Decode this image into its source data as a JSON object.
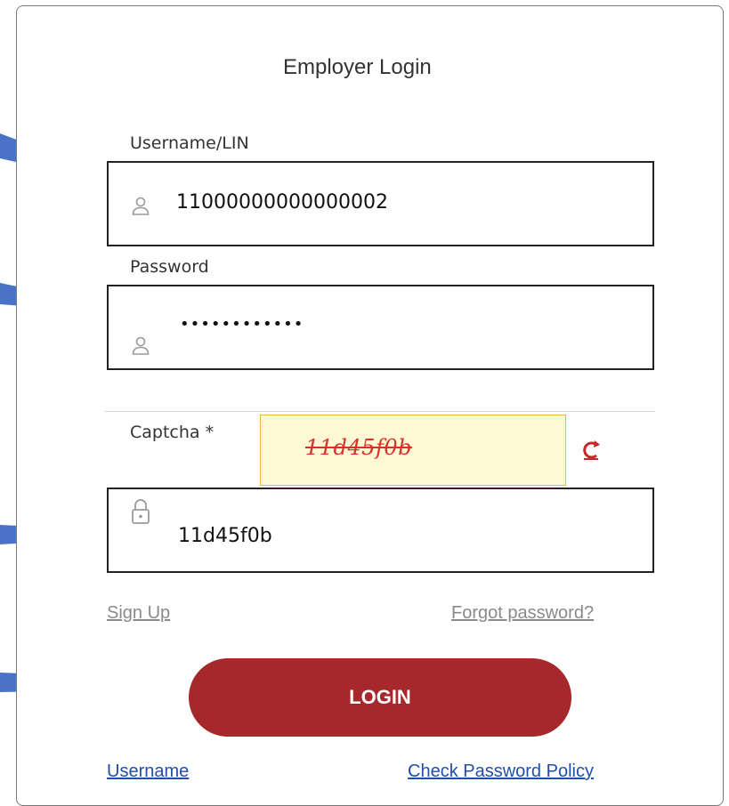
{
  "form": {
    "title": "Employer Login",
    "username": {
      "label": "Username/LIN",
      "value": "11000000000000002",
      "icon": "user-icon"
    },
    "password": {
      "label": "Password",
      "value": "••••••••••••",
      "icon": "user-icon"
    },
    "captcha": {
      "label": "Captcha *",
      "image_text": "11d45f0b",
      "refresh_icon": "refresh-icon",
      "input_value": "11d45f0b",
      "input_icon": "lock-icon"
    },
    "links": {
      "sign_up": "Sign Up",
      "forgot_password": "Forgot password?",
      "username": "Username",
      "check_password_policy": "Check Password Policy"
    },
    "login_button": "LOGIN"
  },
  "colors": {
    "login_button": "#a6282a",
    "captcha_text": "#d8302a",
    "captcha_bg": "#fff8d4",
    "link_blue": "#1f4fa8",
    "pointer": "#4a73c7"
  }
}
